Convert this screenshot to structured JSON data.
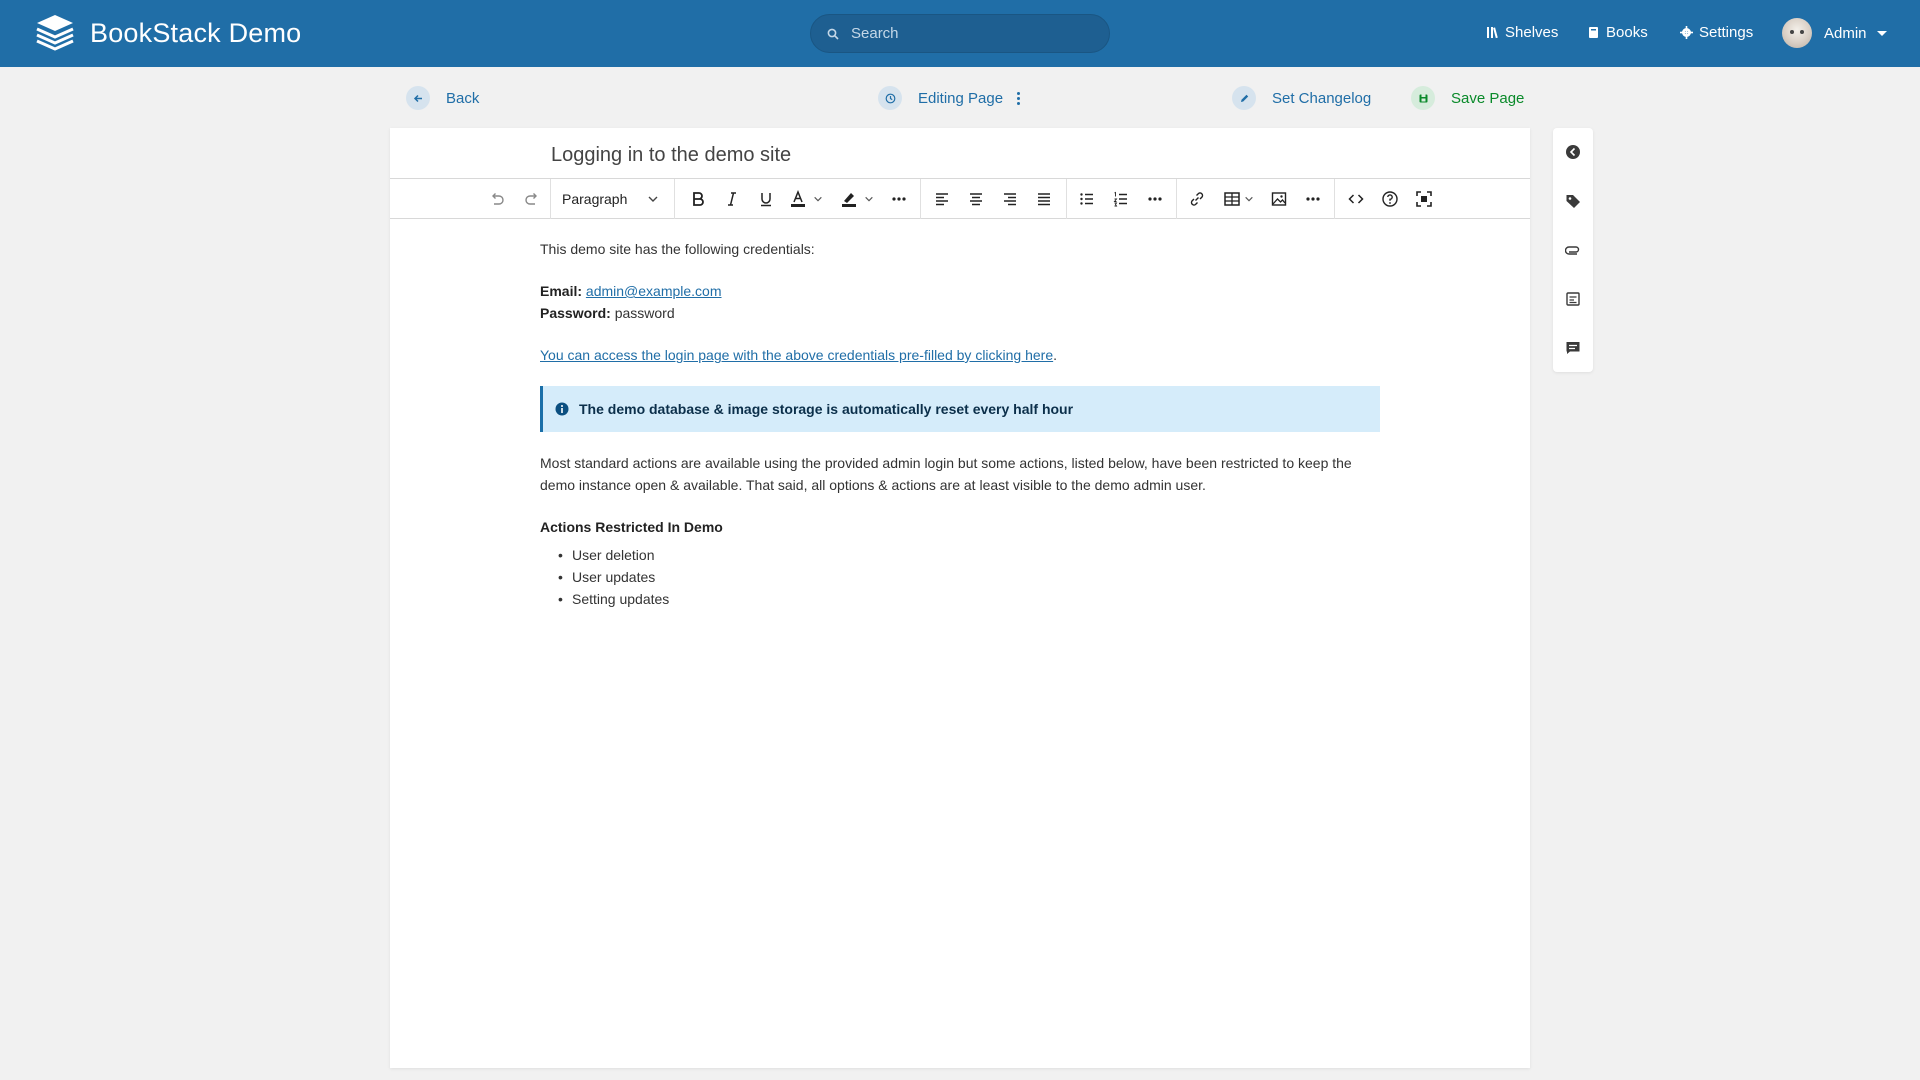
{
  "app": {
    "title": "BookStack Demo",
    "search_placeholder": "Search",
    "nav": {
      "shelves": "Shelves",
      "books": "Books",
      "settings": "Settings"
    },
    "user_name": "Admin"
  },
  "actions": {
    "back": "Back",
    "editing": "Editing Page",
    "changelog": "Set Changelog",
    "save": "Save Page"
  },
  "editor": {
    "page_title": "Logging in to the demo site",
    "block_format": "Paragraph"
  },
  "content": {
    "intro": "This demo site has the following credentials:",
    "email_label": "Email:",
    "email_value": "admin@example.com",
    "password_label": "Password:",
    "password_value": "password",
    "login_link": "You can access the login page with the above credentials pre-filled by clicking here",
    "login_link_suffix": ".",
    "callout": "The demo database & image storage is automatically reset every half hour",
    "para": "Most standard actions are available using the provided admin login but some actions, listed below, have been restricted to keep the demo instance open & available. That said, all options & actions are at least visible to the demo admin user.",
    "heading": "Actions Restricted In Demo",
    "list": [
      "User deletion",
      "User updates",
      "Setting updates"
    ]
  },
  "colors": {
    "header": "#206ea7",
    "callout_bg": "#d5ecfa",
    "save_green": "#0a8a2a"
  },
  "icons": {
    "toolbar": [
      "undo-icon",
      "redo-icon",
      "bold-icon",
      "italic-icon",
      "underline-icon",
      "text-color-icon",
      "highlight-icon",
      "more-icon",
      "align-left-icon",
      "align-center-icon",
      "align-right-icon",
      "align-justify-icon",
      "bullet-list-icon",
      "numbered-list-icon",
      "link-icon",
      "table-icon",
      "image-icon",
      "code-icon",
      "help-icon",
      "fullscreen-icon"
    ],
    "sidebar": [
      "navigate-icon",
      "tag-icon",
      "attachment-icon",
      "templates-icon",
      "comments-icon"
    ]
  }
}
